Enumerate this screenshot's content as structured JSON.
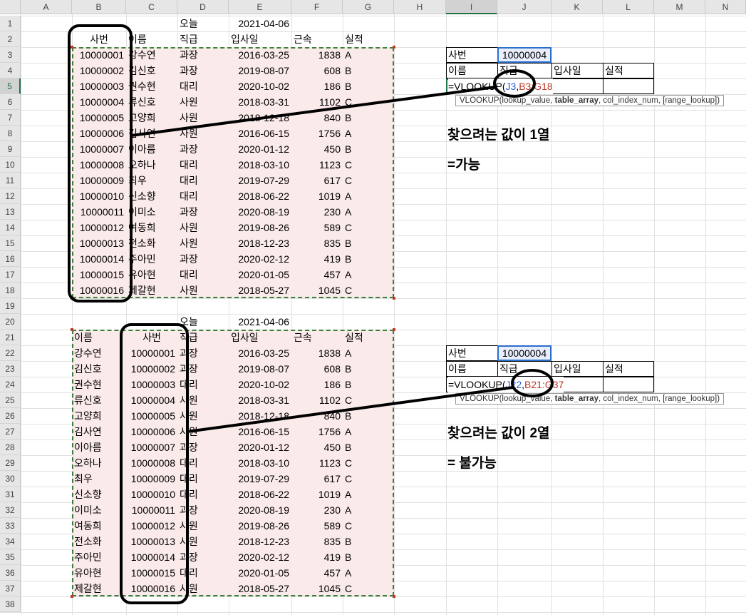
{
  "columns": [
    "A",
    "B",
    "C",
    "D",
    "E",
    "F",
    "G",
    "H",
    "I",
    "J",
    "K",
    "L",
    "M",
    "N"
  ],
  "active_column": "I",
  "active_row": "5",
  "table1": {
    "today_label": "오늘",
    "today_value": "2021-04-06",
    "headers": [
      "사번",
      "이름",
      "직급",
      "입사일",
      "근속",
      "실적"
    ],
    "rows": [
      [
        "10000001",
        "강수연",
        "과장",
        "2016-03-25",
        "1838",
        "A"
      ],
      [
        "10000002",
        "김신호",
        "과장",
        "2019-08-07",
        "608",
        "B"
      ],
      [
        "10000003",
        "권수현",
        "대리",
        "2020-10-02",
        "186",
        "B"
      ],
      [
        "10000004",
        "류신호",
        "사원",
        "2018-03-31",
        "1102",
        "C"
      ],
      [
        "10000005",
        "고양희",
        "사원",
        "2018-12-18",
        "840",
        "B"
      ],
      [
        "10000006",
        "김사연",
        "사원",
        "2016-06-15",
        "1756",
        "A"
      ],
      [
        "10000007",
        "이아름",
        "과장",
        "2020-01-12",
        "450",
        "B"
      ],
      [
        "10000008",
        "오하나",
        "대리",
        "2018-03-10",
        "1123",
        "C"
      ],
      [
        "10000009",
        "최우",
        "대리",
        "2019-07-29",
        "617",
        "C"
      ],
      [
        "10000010",
        "신소향",
        "대리",
        "2018-06-22",
        "1019",
        "A"
      ],
      [
        "10000011",
        "이미소",
        "과장",
        "2020-08-19",
        "230",
        "A"
      ],
      [
        "10000012",
        "여동희",
        "사원",
        "2019-08-26",
        "589",
        "C"
      ],
      [
        "10000013",
        "전소화",
        "사원",
        "2018-12-23",
        "835",
        "B"
      ],
      [
        "10000014",
        "주아민",
        "과장",
        "2020-02-12",
        "419",
        "B"
      ],
      [
        "10000015",
        "유아현",
        "대리",
        "2020-01-05",
        "457",
        "A"
      ],
      [
        "10000016",
        "제갈현",
        "사원",
        "2018-05-27",
        "1045",
        "C"
      ]
    ]
  },
  "table2": {
    "today_label": "오늘",
    "today_value": "2021-04-06",
    "headers": [
      "이름",
      "사번",
      "직급",
      "입사일",
      "근속",
      "실적"
    ],
    "rows": [
      [
        "강수연",
        "10000001",
        "과장",
        "2016-03-25",
        "1838",
        "A"
      ],
      [
        "김신호",
        "10000002",
        "과장",
        "2019-08-07",
        "608",
        "B"
      ],
      [
        "권수현",
        "10000003",
        "대리",
        "2020-10-02",
        "186",
        "B"
      ],
      [
        "류신호",
        "10000004",
        "사원",
        "2018-03-31",
        "1102",
        "C"
      ],
      [
        "고양희",
        "10000005",
        "사원",
        "2018-12-18",
        "840",
        "B"
      ],
      [
        "김사연",
        "10000006",
        "사원",
        "2016-06-15",
        "1756",
        "A"
      ],
      [
        "이아름",
        "10000007",
        "과장",
        "2020-01-12",
        "450",
        "B"
      ],
      [
        "오하나",
        "10000008",
        "대리",
        "2018-03-10",
        "1123",
        "C"
      ],
      [
        "최우",
        "10000009",
        "대리",
        "2019-07-29",
        "617",
        "C"
      ],
      [
        "신소향",
        "10000010",
        "대리",
        "2018-06-22",
        "1019",
        "A"
      ],
      [
        "이미소",
        "10000011",
        "과장",
        "2020-08-19",
        "230",
        "A"
      ],
      [
        "여동희",
        "10000012",
        "사원",
        "2019-08-26",
        "589",
        "C"
      ],
      [
        "전소화",
        "10000013",
        "사원",
        "2018-12-23",
        "835",
        "B"
      ],
      [
        "주아민",
        "10000014",
        "과장",
        "2020-02-12",
        "419",
        "B"
      ],
      [
        "유아현",
        "10000015",
        "대리",
        "2020-01-05",
        "457",
        "A"
      ],
      [
        "제갈현",
        "10000016",
        "사원",
        "2018-05-27",
        "1045",
        "C"
      ]
    ]
  },
  "lookup1": {
    "key_label": "사번",
    "key_value": "10000004",
    "labels": [
      "이름",
      "직급",
      "입사일",
      "실적"
    ],
    "formula_prefix": "=VLOOKUP(",
    "formula_arg1": "J3",
    "formula_sep": ",",
    "formula_arg2": "B3:G18",
    "tooltip_fn": "VLOOKUP(lookup_value, ",
    "tooltip_bold": "table_array",
    "tooltip_rest": ", col_index_num, [range_lookup])",
    "note_line1": "찾으려는 값이 1열",
    "note_line2": "=가능"
  },
  "lookup2": {
    "key_label": "사번",
    "key_value": "10000004",
    "labels": [
      "이름",
      "직급",
      "입사일",
      "실적"
    ],
    "formula_prefix": "=VLOOKUP(",
    "formula_arg1": "J22",
    "formula_sep": ",",
    "formula_arg2": "B21:G37",
    "tooltip_fn": "VLOOKUP(lookup_value, ",
    "tooltip_bold": "table_array",
    "tooltip_rest": ", col_index_num, [range_lookup])",
    "note_line1": "찾으려는 값이 2열",
    "note_line2": "= 불가능"
  },
  "colors": {
    "header_bg": "#e6e6e6",
    "range_fill": "#fbeaea",
    "marquee": "#3a7f3a",
    "selection": "#2b6ecf",
    "ref_blue": "#2b5fd9",
    "ref_red": "#c0392b",
    "annotation": "#000000"
  }
}
